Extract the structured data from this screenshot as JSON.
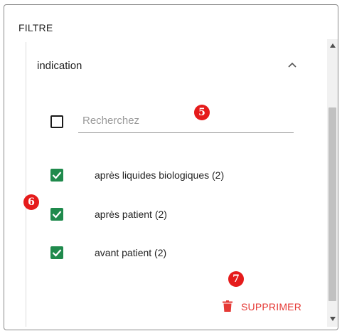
{
  "panel": {
    "title": "FILTRE"
  },
  "section": {
    "title": "indication",
    "expanded": true
  },
  "search": {
    "placeholder": "Recherchez",
    "value": "",
    "select_all_checked": false
  },
  "options": [
    {
      "label": "après liquides biologiques (2)",
      "checked": true
    },
    {
      "label": "après patient (2)",
      "checked": true
    },
    {
      "label": "avant patient (2)",
      "checked": true
    }
  ],
  "actions": {
    "delete_label": "SUPPRIMER"
  },
  "markers": {
    "search": "5",
    "options": "6",
    "delete": "7"
  },
  "icons": {
    "chevron": "chevron-up-icon",
    "checkbox": "checkbox-icon",
    "trash": "trash-icon",
    "scroll_up": "arrow-up-icon",
    "scroll_down": "arrow-down-icon"
  },
  "colors": {
    "checked": "#1f8a4c",
    "danger": "#e53935",
    "marker": "#e51b1b"
  }
}
